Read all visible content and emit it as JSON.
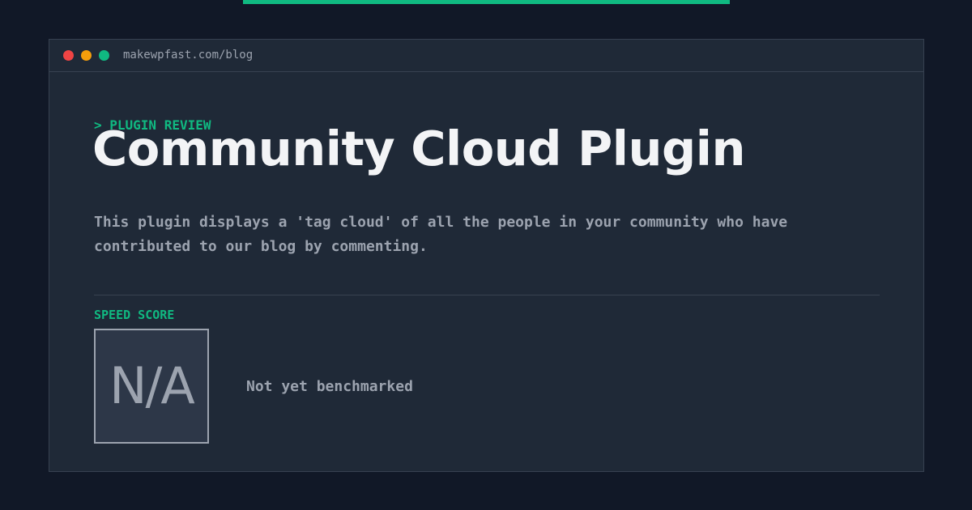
{
  "colors": {
    "background": "#111827",
    "panel": "#1f2937",
    "accent": "#10b981",
    "title_text": "#f3f4f6",
    "muted_text": "#9ca3af",
    "dot_red": "#ef4444",
    "dot_yellow": "#f59e0b",
    "dot_green": "#10b981"
  },
  "window": {
    "url": "makewpfast.com/blog",
    "controls": [
      "close-dot",
      "minimize-dot",
      "maximize-dot"
    ]
  },
  "article": {
    "kicker": "> PLUGIN REVIEW",
    "title": "Community Cloud Plugin",
    "description": "This plugin displays a 'tag cloud' of all the people in your community who have contributed to our blog by commenting."
  },
  "speed": {
    "label": "SPEED SCORE",
    "value": "N/A",
    "status": "Not yet benchmarked"
  }
}
